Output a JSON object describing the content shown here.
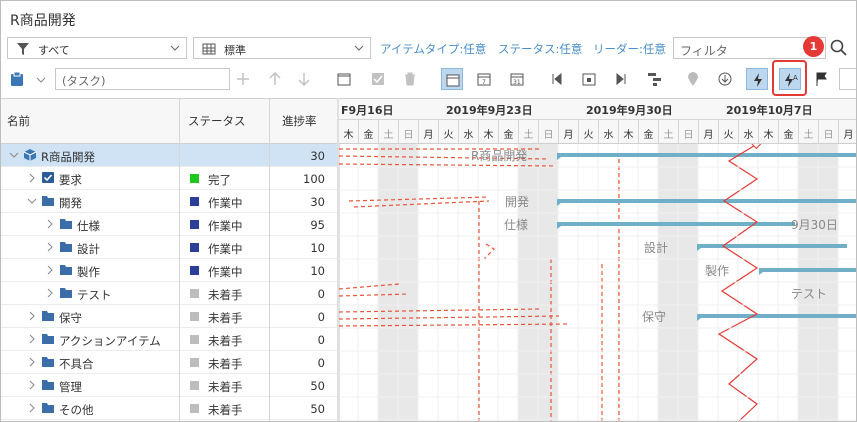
{
  "title": "R商品開発",
  "toolbar1": {
    "filter_select": "すべて",
    "view_select": "標準",
    "links": [
      "アイテムタイプ:任意",
      "ステータス:任意",
      "リーダー:任意"
    ],
    "filter_placeholder": "フィルタ",
    "badge": "1"
  },
  "toolbar2": {
    "task_placeholder": "(タスク)"
  },
  "columns": {
    "name": "名前",
    "status": "ステータス",
    "progress": "進捗率"
  },
  "rows": [
    {
      "name": "R商品開発",
      "status": "",
      "progress": "30",
      "level": 0,
      "icon": "box-icon",
      "status_color": ""
    },
    {
      "name": "要求",
      "status": "完了",
      "progress": "100",
      "level": 1,
      "icon": "checkbox-icon",
      "status_color": "#1ec81e"
    },
    {
      "name": "開発",
      "status": "作業中",
      "progress": "30",
      "level": 1,
      "icon": "folder-icon",
      "status_color": "#2b3f99"
    },
    {
      "name": "仕様",
      "status": "作業中",
      "progress": "95",
      "level": 2,
      "icon": "folder-icon",
      "status_color": "#2b3f99"
    },
    {
      "name": "設計",
      "status": "作業中",
      "progress": "10",
      "level": 2,
      "icon": "folder-icon",
      "status_color": "#2b3f99"
    },
    {
      "name": "製作",
      "status": "作業中",
      "progress": "10",
      "level": 2,
      "icon": "folder-icon",
      "status_color": "#2b3f99"
    },
    {
      "name": "テスト",
      "status": "未着手",
      "progress": "0",
      "level": 2,
      "icon": "folder-icon",
      "status_color": "#bdbdbd"
    },
    {
      "name": "保守",
      "status": "未着手",
      "progress": "0",
      "level": 1,
      "icon": "folder-icon",
      "status_color": "#bdbdbd"
    },
    {
      "name": "アクションアイテム",
      "status": "未着手",
      "progress": "0",
      "level": 1,
      "icon": "folder-icon",
      "status_color": "#bdbdbd"
    },
    {
      "name": "不具合",
      "status": "未着手",
      "progress": "0",
      "level": 1,
      "icon": "folder-icon",
      "status_color": "#bdbdbd"
    },
    {
      "name": "管理",
      "status": "未着手",
      "progress": "50",
      "level": 1,
      "icon": "folder-icon",
      "status_color": "#bdbdbd"
    },
    {
      "name": "その他",
      "status": "未着手",
      "progress": "50",
      "level": 1,
      "icon": "folder-icon",
      "status_color": "#bdbdbd"
    }
  ],
  "gantt": {
    "weeks": [
      "F9月16日",
      "2019年9月23日",
      "2019年9月30日",
      "2019年10月7日"
    ],
    "days": [
      "木",
      "金",
      "土",
      "日",
      "月",
      "火",
      "水",
      "木",
      "金",
      "土",
      "日",
      "月",
      "火",
      "水",
      "木",
      "金",
      "土",
      "日",
      "月",
      "火",
      "水",
      "木",
      "金",
      "土",
      "日",
      "月"
    ],
    "bar_labels": [
      "R商品開発",
      "開発",
      "仕様",
      "9月30日",
      "設計",
      "製作",
      "テスト",
      "保守"
    ],
    "colors": {
      "bar": "#6fb0c8",
      "critical": "#e8553a",
      "today": "#e53935",
      "weekend": "#e8e8e8"
    }
  }
}
